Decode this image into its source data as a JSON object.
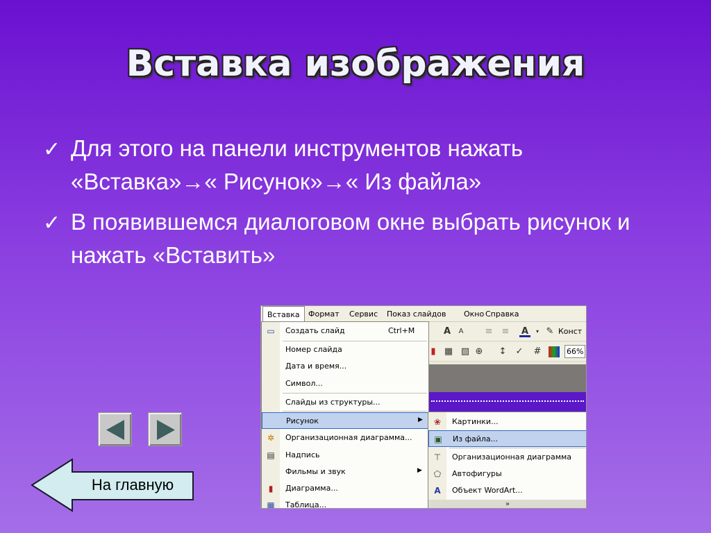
{
  "slide": {
    "title": "Вставка изображения",
    "bullets": [
      "Для этого на панели инструментов нажать «Вставка»→« Рисунок»→« Из файла»",
      "В появившемся диалоговом окне выбрать рисунок и нажать «Вставить»"
    ]
  },
  "screenshot": {
    "menubar": [
      "Вставка",
      "Формат",
      "Сервис",
      "Показ слайдов",
      "Окно",
      "Справка"
    ],
    "toolbar_right_text": "Конст",
    "zoom": "66%",
    "insert_menu": [
      {
        "label": "Создать слайд",
        "shortcut": "Ctrl+M",
        "icon": "new-slide-icon"
      },
      {
        "label": "Номер слайда"
      },
      {
        "label": "Дата и время..."
      },
      {
        "label": "Символ..."
      },
      {
        "label": "Слайды из структуры..."
      },
      {
        "label": "Рисунок",
        "submenu": true,
        "highlighted": true
      },
      {
        "label": "Организационная диаграмма...",
        "icon": "org-chart-icon"
      },
      {
        "label": "Надпись",
        "icon": "textbox-icon"
      },
      {
        "label": "Фильмы и звук",
        "submenu": true
      },
      {
        "label": "Диаграмма...",
        "icon": "chart-icon"
      },
      {
        "label": "Таблица...",
        "icon": "table-icon"
      }
    ],
    "picture_submenu": [
      {
        "label": "Картинки...",
        "icon": "clipart-icon"
      },
      {
        "label": "Из файла...",
        "icon": "from-file-icon",
        "highlighted": true
      },
      {
        "label": "Организационная диаграмма",
        "icon": "org-chart-icon"
      },
      {
        "label": "Автофигуры",
        "icon": "autoshapes-icon"
      },
      {
        "label": "Объект WordArt...",
        "icon": "wordart-icon"
      }
    ],
    "submenu_more": "»"
  },
  "nav": {
    "home_label": "На главную"
  },
  "colors": {
    "background_top": "#6a10d0",
    "background_bottom": "#a56ee8",
    "menu_highlight": "#c1d2ee"
  }
}
